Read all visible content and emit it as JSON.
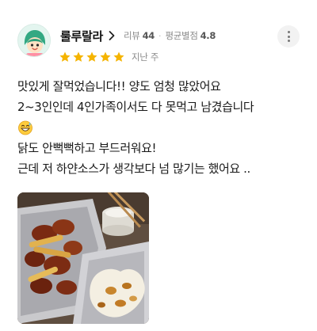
{
  "author": {
    "name": "룰루랄라",
    "review_count_label": "리뷰",
    "review_count": "44",
    "avg_rating_label": "평균별점",
    "avg_rating": "4.8"
  },
  "rating": {
    "stars": 5,
    "max_stars": 5,
    "star_color": "#f5b400",
    "time_ago": "지난 주"
  },
  "review": {
    "lines": [
      "맛있게 잘먹었습니다!! 양도 엄청 많았어요",
      "2~3인인데 4인가족이서도 다 못먹고 남겼습니다",
      "닭도 안뻑뻑하고 부드러워요!",
      "근데 저 하얀소스가 생각보다 넘 많기는 했어요 .."
    ],
    "emoji": "grinning-sweat-emoji"
  },
  "photo": {
    "subject": "fried chicken with white sauce in foil"
  },
  "icons": {
    "chevron": "chevron-right-icon",
    "more": "more-vertical-icon",
    "star": "star-icon"
  }
}
